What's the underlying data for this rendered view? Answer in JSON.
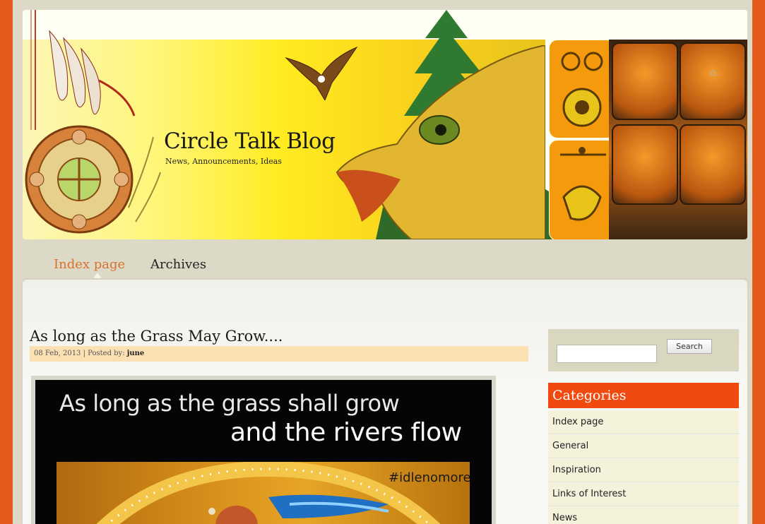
{
  "header": {
    "site_title": "Circle Talk Blog",
    "tagline": "News, Announcements, Ideas"
  },
  "nav": {
    "items": [
      {
        "label": "Index page",
        "active": true
      },
      {
        "label": "Archives",
        "active": false
      }
    ]
  },
  "post": {
    "title": "As long as the Grass May Grow....",
    "date": "08 Feb, 2013",
    "posted_by_label": "| Posted by:",
    "author": "june",
    "image": {
      "line1": "As long as the grass shall grow",
      "line2": "and the rivers flow",
      "hashtag": "#idlenomore"
    }
  },
  "sidebar": {
    "search": {
      "placeholder": "",
      "button_label": "Search"
    },
    "categories": {
      "heading": "Categories",
      "items": [
        "Index page",
        "General",
        "Inspiration",
        "Links of Interest",
        "News"
      ]
    }
  },
  "colors": {
    "accent_orange": "#f04a10",
    "nav_active": "#d8722e",
    "meta_bar": "#fbe0b4",
    "page_border": "#e35a1a"
  },
  "icons": [
    "home-icon"
  ]
}
